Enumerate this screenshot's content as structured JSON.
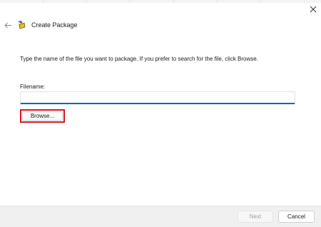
{
  "header": {
    "title": "Create Package",
    "back_icon": "back-arrow-icon",
    "close_icon": "close-icon",
    "package_icon": "package-icon"
  },
  "main": {
    "instructions": "Type the name of the file you want to package. If you prefer to search for the file, click Browse.",
    "filename_label": "Filename:",
    "filename_value": "",
    "browse_label": "Browse..."
  },
  "footer": {
    "next_label": "Next",
    "cancel_label": "Cancel"
  },
  "colors": {
    "accent": "#0067c0",
    "highlight_border": "#d9171e"
  }
}
